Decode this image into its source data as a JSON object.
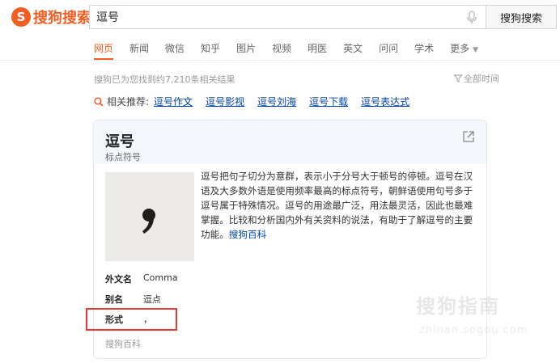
{
  "logo": {
    "mark": "S",
    "text": "搜狗搜索"
  },
  "search": {
    "query": "逗号",
    "button_label": "搜狗搜索"
  },
  "nav": {
    "items": [
      "网页",
      "新闻",
      "微信",
      "知乎",
      "图片",
      "视频",
      "明医",
      "英文",
      "问问",
      "学术",
      "更多"
    ]
  },
  "results": {
    "count_text": "搜狗已为您找到约7,210条相关结果",
    "time_filter": "全部时间"
  },
  "related": {
    "label": "相关推荐:",
    "items": [
      "逗号作文",
      "逗号影视",
      "逗号刘海",
      "逗号下载",
      "逗号表达式"
    ]
  },
  "card": {
    "title": "逗号",
    "subtitle": "标点符号",
    "description": "逗号把句子切分为意群，表示小于分号大于顿号的停顿。逗号在汉语及大多数外语是使用频率最高的标点符号，朝鲜语使用句号多于逗号属于特殊情况。逗号的用途最广泛，用法最灵活，因此也最难掌握。比较和分析国内外有关资料的说法，有助于了解逗号的主要功能。",
    "desc_link": "搜狗百科",
    "info": [
      {
        "key": "外文名",
        "value": "Comma"
      },
      {
        "key": "别名",
        "value": "逗点"
      },
      {
        "key": "形式",
        "value": "，"
      }
    ],
    "source": "搜狗百科"
  },
  "watermark": {
    "text": "搜狗指南",
    "url": "zhinan.sogou.com"
  },
  "colors": {
    "brand": "#f25d22",
    "link": "#0044aa",
    "highlight": "#e53935",
    "card_head": "#f4f7fc"
  }
}
